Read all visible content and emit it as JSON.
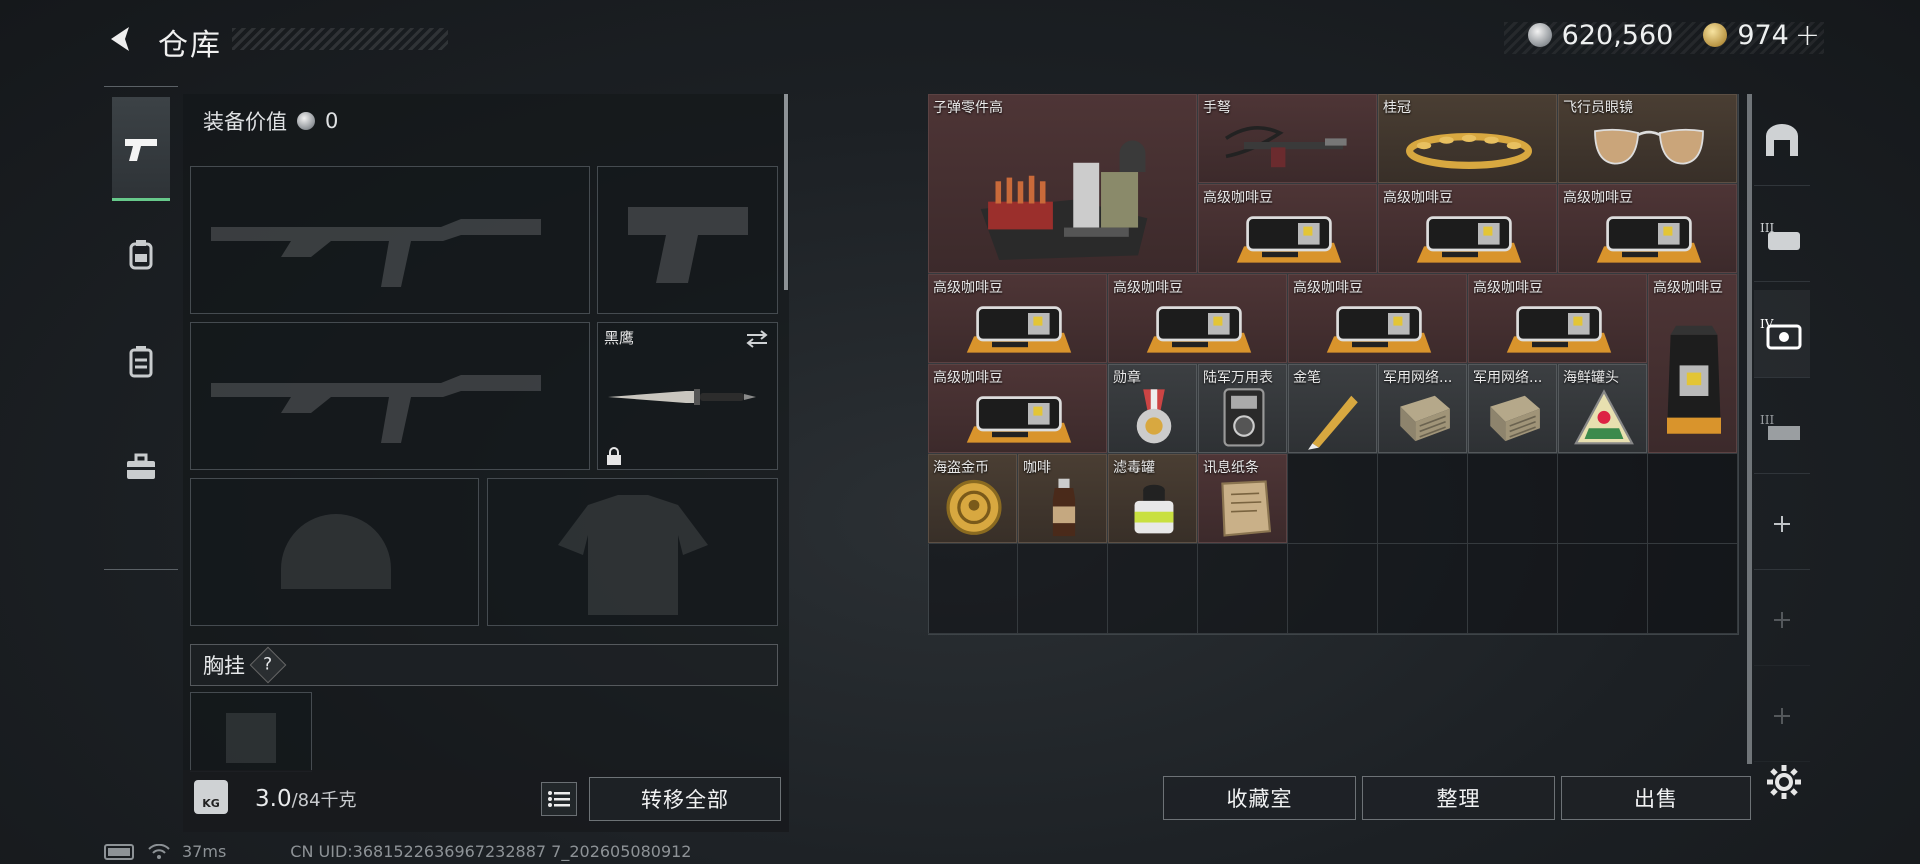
{
  "header": {
    "title": "仓库",
    "back_icon": "back-arrow-icon"
  },
  "currency": {
    "silver": "620,560",
    "gold": "974",
    "plus": "+"
  },
  "left_nav": {
    "items": [
      {
        "icon": "pistol-icon",
        "active": true
      },
      {
        "icon": "backpack-icon",
        "active": false
      },
      {
        "icon": "container-icon",
        "active": false
      },
      {
        "icon": "toolbox-icon",
        "active": false
      }
    ]
  },
  "equipment": {
    "value_label": "装备价值",
    "value": "0",
    "melee_name": "黑鹰",
    "chest_rig_label": "胸挂",
    "chest_help": "?",
    "weight_value": "3.0",
    "weight_capacity": "/84千克",
    "weight_icon_text": "KG",
    "transfer_all_label": "转移全部"
  },
  "stash": {
    "items": [
      {
        "name": "子弹零件高",
        "style": "red",
        "art": "ammo-parts-crate"
      },
      {
        "name": "手弩",
        "style": "red",
        "art": "hand-crossbow"
      },
      {
        "name": "桂冠",
        "style": "tan",
        "art": "laurel-crown"
      },
      {
        "name": "飞行员眼镜",
        "style": "tan",
        "art": "aviator-glasses"
      },
      {
        "name": "高级咖啡豆",
        "style": "red",
        "art": "coffee-beans"
      },
      {
        "name": "高级咖啡豆",
        "style": "red",
        "art": "coffee-beans"
      },
      {
        "name": "高级咖啡豆",
        "style": "red",
        "art": "coffee-beans"
      },
      {
        "name": "高级咖啡豆",
        "style": "red",
        "art": "coffee-beans"
      },
      {
        "name": "高级咖啡豆",
        "style": "red",
        "art": "coffee-beans"
      },
      {
        "name": "高级咖啡豆",
        "style": "red",
        "art": "coffee-beans"
      },
      {
        "name": "高级咖啡豆",
        "style": "red",
        "art": "coffee-beans"
      },
      {
        "name": "高级咖啡豆",
        "style": "red",
        "art": "coffee-bag"
      },
      {
        "name": "高级咖啡豆",
        "style": "red",
        "art": "coffee-beans"
      },
      {
        "name": "勋章",
        "style": "gray",
        "art": "medal"
      },
      {
        "name": "陆军万用表",
        "style": "gray",
        "art": "multimeter"
      },
      {
        "name": "金笔",
        "style": "gray",
        "art": "gold-pen"
      },
      {
        "name": "军用网络...",
        "style": "gray",
        "art": "network-module"
      },
      {
        "name": "军用网络...",
        "style": "gray",
        "art": "network-module"
      },
      {
        "name": "海鲜罐头",
        "style": "gray",
        "art": "seafood-can"
      },
      {
        "name": "海盗金币",
        "style": "tan",
        "art": "pirate-coin"
      },
      {
        "name": "咖啡",
        "style": "tan",
        "art": "coffee-bottle"
      },
      {
        "name": "滤毒罐",
        "style": "tan",
        "art": "filter-canister"
      },
      {
        "name": "讯息纸条",
        "style": "red",
        "art": "message-note"
      }
    ],
    "collection_label": "收藏室",
    "sort_label": "整理",
    "sell_label": "出售"
  },
  "right_nav": {
    "items": [
      "arch-icon",
      "tier-iii-backpack-icon",
      "tier-iv-backpack-icon",
      "tier-iii-rig-icon",
      "add-icon",
      "add-icon",
      "add-icon"
    ]
  },
  "footer": {
    "ping": "37ms",
    "uid": "CN UID:3681522636967232887 7_202605080912"
  },
  "colors": {
    "accent_green": "#67c98b",
    "item_red": "#4e3536",
    "item_tan": "#4a3e33"
  }
}
